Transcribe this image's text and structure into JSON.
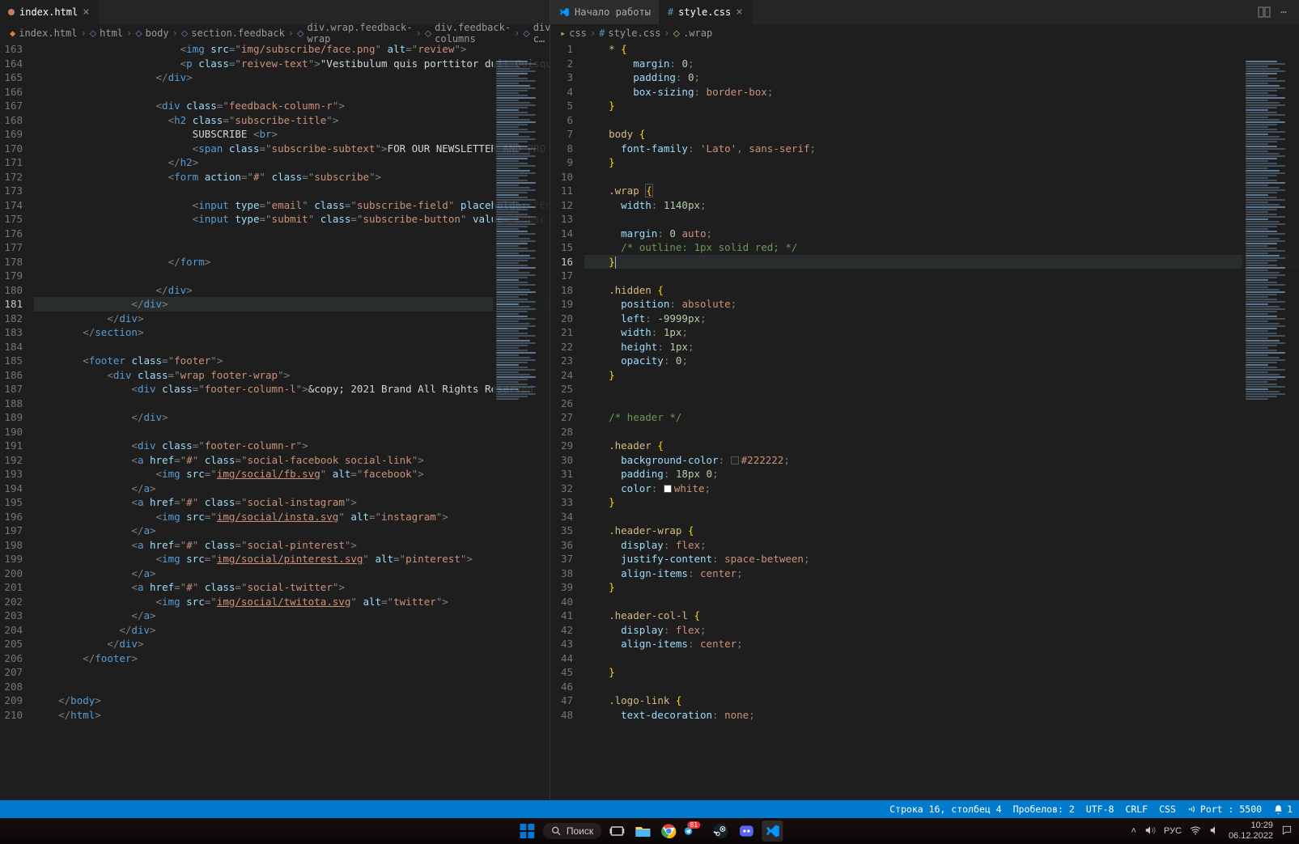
{
  "tabs_left": {
    "t0": {
      "label": "index.html",
      "modified": true
    }
  },
  "tabs_right": {
    "t0": {
      "label": "Начало работы"
    },
    "t1": {
      "label": "style.css"
    }
  },
  "breadcrumb_left": [
    "index.html",
    "html",
    "body",
    "section.feedback",
    "div.wrap.feedback-wrap",
    "div.feedback-columns",
    "div.feedback-c…"
  ],
  "breadcrumb_right": [
    "css",
    "style.css",
    ".wrap"
  ],
  "left_lines": {
    "start": 163,
    "active_abs": 181,
    "lines": [
      {
        "n": 163,
        "html": "                    <span class='t-punc'>&lt;</span><span class='t-tag'>img</span> <span class='t-attr'>src</span><span class='t-punc'>=\"</span><span class='t-str'>img/subscribe/face.png</span><span class='t-punc'>\"</span> <span class='t-attr'>alt</span><span class='t-punc'>=\"</span><span class='t-str'>review</span><span class='t-punc'>\"&gt;</span>"
      },
      {
        "n": 164,
        "html": "                    <span class='t-punc'>&lt;</span><span class='t-tag'>p</span> <span class='t-attr'>class</span><span class='t-punc'>=\"</span><span class='t-str'>reivew-text</span><span class='t-punc'>\"&gt;</span><span class='t-text'>\"Vestibulum quis porttitor dui! Quisque </span>"
      },
      {
        "n": 165,
        "html": "                <span class='t-punc'>&lt;/</span><span class='t-tag'>div</span><span class='t-punc'>&gt;</span>"
      },
      {
        "n": 166,
        "html": ""
      },
      {
        "n": 167,
        "html": "                <span class='t-punc'>&lt;</span><span class='t-tag'>div</span> <span class='t-attr'>class</span><span class='t-punc'>=\"</span><span class='t-str'>feedback-column-r</span><span class='t-punc'>\"&gt;</span>"
      },
      {
        "n": 168,
        "html": "                  <span class='t-punc'>&lt;</span><span class='t-tag'>h2</span> <span class='t-attr'>class</span><span class='t-punc'>=\"</span><span class='t-str'>subscribe-title</span><span class='t-punc'>\"&gt;</span>"
      },
      {
        "n": 169,
        "html": "                      <span class='t-text'>SUBSCRIBE</span> <span class='t-punc'>&lt;</span><span class='t-tag'>br</span><span class='t-punc'>&gt;</span>"
      },
      {
        "n": 170,
        "html": "                      <span class='t-punc'>&lt;</span><span class='t-tag'>span</span> <span class='t-attr'>class</span><span class='t-punc'>=\"</span><span class='t-str'>subscribe-subtext</span><span class='t-punc'>\"&gt;</span><span class='t-text'>FOR OUR NEWSLETTER AND PRO</span>"
      },
      {
        "n": 171,
        "html": "                  <span class='t-punc'>&lt;/</span><span class='t-tag'>h2</span><span class='t-punc'>&gt;</span>"
      },
      {
        "n": 172,
        "html": "                  <span class='t-punc'>&lt;</span><span class='t-tag'>form</span> <span class='t-attr'>action</span><span class='t-punc'>=\"</span><span class='t-str'>#</span><span class='t-punc'>\"</span> <span class='t-attr'>class</span><span class='t-punc'>=\"</span><span class='t-str'>subscribe</span><span class='t-punc'>\"&gt;</span>"
      },
      {
        "n": 173,
        "html": ""
      },
      {
        "n": 174,
        "html": "                      <span class='t-punc'>&lt;</span><span class='t-tag'>input</span> <span class='t-attr'>type</span><span class='t-punc'>=\"</span><span class='t-str'>email</span><span class='t-punc'>\"</span> <span class='t-attr'>class</span><span class='t-punc'>=\"</span><span class='t-str'>subscribe-field</span><span class='t-punc'>\"</span> <span class='t-attr'>placeholder</span><span class='t-punc'>=\"</span><span class='t-str'>En</span>"
      },
      {
        "n": 175,
        "html": "                      <span class='t-punc'>&lt;</span><span class='t-tag'>input</span> <span class='t-attr'>type</span><span class='t-punc'>=\"</span><span class='t-str'>submit</span><span class='t-punc'>\"</span> <span class='t-attr'>class</span><span class='t-punc'>=\"</span><span class='t-str'>subscribe-button</span><span class='t-punc'>\"</span> <span class='t-attr'>value</span><span class='t-punc'>=\"</span><span class='t-str'>Subsc</span>"
      },
      {
        "n": 176,
        "html": ""
      },
      {
        "n": 177,
        "html": ""
      },
      {
        "n": 178,
        "html": "                  <span class='t-punc'>&lt;/</span><span class='t-tag'>form</span><span class='t-punc'>&gt;</span>"
      },
      {
        "n": 179,
        "html": ""
      },
      {
        "n": 180,
        "html": "                <span class='t-punc'>&lt;/</span><span class='t-tag'>div</span><span class='t-punc'>&gt;</span>"
      },
      {
        "n": 181,
        "html": "            <span class='t-punc'>&lt;/</span><span class='t-tag'>div</span><span class='t-punc'>&gt;</span>"
      },
      {
        "n": 182,
        "html": "        <span class='t-punc'>&lt;/</span><span class='t-tag'>div</span><span class='t-punc'>&gt;</span>"
      },
      {
        "n": 183,
        "html": "    <span class='t-punc'>&lt;/</span><span class='t-tag'>section</span><span class='t-punc'>&gt;</span>"
      },
      {
        "n": 184,
        "html": ""
      },
      {
        "n": 185,
        "html": "    <span class='t-punc'>&lt;</span><span class='t-tag'>footer</span> <span class='t-attr'>class</span><span class='t-punc'>=\"</span><span class='t-str'>footer</span><span class='t-punc'>\"&gt;</span>"
      },
      {
        "n": 186,
        "html": "        <span class='t-punc'>&lt;</span><span class='t-tag'>div</span> <span class='t-attr'>class</span><span class='t-punc'>=\"</span><span class='t-str'>wrap footer-wrap</span><span class='t-punc'>\"&gt;</span>"
      },
      {
        "n": 187,
        "html": "            <span class='t-punc'>&lt;</span><span class='t-tag'>div</span> <span class='t-attr'>class</span><span class='t-punc'>=\"</span><span class='t-str'>footer-column-l</span><span class='t-punc'>\"&gt;</span><span class='t-text'>&amp;copy; 2021 Brand All Rights Reserved</span>"
      },
      {
        "n": 188,
        "html": ""
      },
      {
        "n": 189,
        "html": "            <span class='t-punc'>&lt;/</span><span class='t-tag'>div</span><span class='t-punc'>&gt;</span>"
      },
      {
        "n": 190,
        "html": ""
      },
      {
        "n": 191,
        "html": "            <span class='t-punc'>&lt;</span><span class='t-tag'>div</span> <span class='t-attr'>class</span><span class='t-punc'>=\"</span><span class='t-str'>footer-column-r</span><span class='t-punc'>\"&gt;</span>"
      },
      {
        "n": 192,
        "html": "            <span class='t-punc'>&lt;</span><span class='t-tag'>a</span> <span class='t-attr'>href</span><span class='t-punc'>=\"</span><span class='t-str'>#</span><span class='t-punc'>\"</span> <span class='t-attr'>class</span><span class='t-punc'>=\"</span><span class='t-str'>social-facebook social-link</span><span class='t-punc'>\"&gt;</span>"
      },
      {
        "n": 193,
        "html": "                <span class='t-punc'>&lt;</span><span class='t-tag'>img</span> <span class='t-attr'>src</span><span class='t-punc'>=\"</span><span class='t-link'>img/social/fb.svg</span><span class='t-punc'>\"</span> <span class='t-attr'>alt</span><span class='t-punc'>=\"</span><span class='t-str'>facebook</span><span class='t-punc'>\"&gt;</span>"
      },
      {
        "n": 194,
        "html": "            <span class='t-punc'>&lt;/</span><span class='t-tag'>a</span><span class='t-punc'>&gt;</span>"
      },
      {
        "n": 195,
        "html": "            <span class='t-punc'>&lt;</span><span class='t-tag'>a</span> <span class='t-attr'>href</span><span class='t-punc'>=\"</span><span class='t-str'>#</span><span class='t-punc'>\"</span> <span class='t-attr'>class</span><span class='t-punc'>=\"</span><span class='t-str'>social-instagram</span><span class='t-punc'>\"&gt;</span>"
      },
      {
        "n": 196,
        "html": "                <span class='t-punc'>&lt;</span><span class='t-tag'>img</span> <span class='t-attr'>src</span><span class='t-punc'>=\"</span><span class='t-link'>img/social/insta.svg</span><span class='t-punc'>\"</span> <span class='t-attr'>alt</span><span class='t-punc'>=\"</span><span class='t-str'>instagram</span><span class='t-punc'>\"&gt;</span>"
      },
      {
        "n": 197,
        "html": "            <span class='t-punc'>&lt;/</span><span class='t-tag'>a</span><span class='t-punc'>&gt;</span>"
      },
      {
        "n": 198,
        "html": "            <span class='t-punc'>&lt;</span><span class='t-tag'>a</span> <span class='t-attr'>href</span><span class='t-punc'>=\"</span><span class='t-str'>#</span><span class='t-punc'>\"</span> <span class='t-attr'>class</span><span class='t-punc'>=\"</span><span class='t-str'>social-pinterest</span><span class='t-punc'>\"&gt;</span>"
      },
      {
        "n": 199,
        "html": "                <span class='t-punc'>&lt;</span><span class='t-tag'>img</span> <span class='t-attr'>src</span><span class='t-punc'>=\"</span><span class='t-link'>img/social/pinterest.svg</span><span class='t-punc'>\"</span> <span class='t-attr'>alt</span><span class='t-punc'>=\"</span><span class='t-str'>pinterest</span><span class='t-punc'>\"&gt;</span>"
      },
      {
        "n": 200,
        "html": "            <span class='t-punc'>&lt;/</span><span class='t-tag'>a</span><span class='t-punc'>&gt;</span>"
      },
      {
        "n": 201,
        "html": "            <span class='t-punc'>&lt;</span><span class='t-tag'>a</span> <span class='t-attr'>href</span><span class='t-punc'>=\"</span><span class='t-str'>#</span><span class='t-punc'>\"</span> <span class='t-attr'>class</span><span class='t-punc'>=\"</span><span class='t-str'>social-twitter</span><span class='t-punc'>\"&gt;</span>"
      },
      {
        "n": 202,
        "html": "                <span class='t-punc'>&lt;</span><span class='t-tag'>img</span> <span class='t-attr'>src</span><span class='t-punc'>=\"</span><span class='t-link'>img/social/twitota.svg</span><span class='t-punc'>\"</span> <span class='t-attr'>alt</span><span class='t-punc'>=\"</span><span class='t-str'>twitter</span><span class='t-punc'>\"&gt;</span>"
      },
      {
        "n": 203,
        "html": "            <span class='t-punc'>&lt;/</span><span class='t-tag'>a</span><span class='t-punc'>&gt;</span>"
      },
      {
        "n": 204,
        "html": "          <span class='t-punc'>&lt;/</span><span class='t-tag'>div</span><span class='t-punc'>&gt;</span>"
      },
      {
        "n": 205,
        "html": "        <span class='t-punc'>&lt;/</span><span class='t-tag'>div</span><span class='t-punc'>&gt;</span>"
      },
      {
        "n": 206,
        "html": "    <span class='t-punc'>&lt;/</span><span class='t-tag'>footer</span><span class='t-punc'>&gt;</span>"
      },
      {
        "n": 207,
        "html": ""
      },
      {
        "n": 208,
        "html": ""
      },
      {
        "n": 209,
        "html": "<span class='t-punc'>&lt;/</span><span class='t-tag'>body</span><span class='t-punc'>&gt;</span>"
      },
      {
        "n": 210,
        "html": "<span class='t-punc'>&lt;/</span><span class='t-tag'>html</span><span class='t-punc'>&gt;</span>"
      }
    ]
  },
  "right_lines": {
    "start": 1,
    "active_abs": 16,
    "lines": [
      {
        "n": 1,
        "html": "<span class='t-sel'>*</span> <span class='t-brace'>{</span>"
      },
      {
        "n": 2,
        "html": "    <span class='t-prop'>margin</span><span class='t-punc'>:</span> <span class='t-num'>0</span><span class='t-punc'>;</span>"
      },
      {
        "n": 3,
        "html": "    <span class='t-prop'>padding</span><span class='t-punc'>:</span> <span class='t-num'>0</span><span class='t-punc'>;</span>"
      },
      {
        "n": 4,
        "html": "    <span class='t-prop'>box-sizing</span><span class='t-punc'>:</span> <span class='t-val'>border-box</span><span class='t-punc'>;</span>"
      },
      {
        "n": 5,
        "html": "<span class='t-brace'>}</span>"
      },
      {
        "n": 6,
        "html": ""
      },
      {
        "n": 7,
        "html": "<span class='t-sel'>body</span> <span class='t-brace'>{</span>"
      },
      {
        "n": 8,
        "html": "  <span class='t-prop'>font-family</span><span class='t-punc'>:</span> <span class='t-val'>'Lato'</span><span class='t-punc'>,</span> <span class='t-val'>sans-serif</span><span class='t-punc'>;</span>"
      },
      {
        "n": 9,
        "html": "<span class='t-brace'>}</span>"
      },
      {
        "n": 10,
        "html": ""
      },
      {
        "n": 11,
        "html": "<span class='t-sel'>.wrap</span> <span class='t-brace' style='border:1px solid #555'>{</span>"
      },
      {
        "n": 12,
        "html": "  <span class='t-prop'>width</span><span class='t-punc'>:</span> <span class='t-num'>1140px</span><span class='t-punc'>;</span>"
      },
      {
        "n": 13,
        "html": ""
      },
      {
        "n": 14,
        "html": "  <span class='t-prop'>margin</span><span class='t-punc'>:</span> <span class='t-num'>0</span> <span class='t-val'>auto</span><span class='t-punc'>;</span>"
      },
      {
        "n": 15,
        "html": "  <span class='t-com'>/* outline: 1px solid red; */</span>"
      },
      {
        "n": 16,
        "html": "<span class='t-brace'>}</span><span class='cursor'></span>"
      },
      {
        "n": 17,
        "html": ""
      },
      {
        "n": 18,
        "html": "<span class='t-sel'>.hidden</span> <span class='t-brace'>{</span>"
      },
      {
        "n": 19,
        "html": "  <span class='t-prop'>position</span><span class='t-punc'>:</span> <span class='t-val'>absolute</span><span class='t-punc'>;</span>"
      },
      {
        "n": 20,
        "html": "  <span class='t-prop'>left</span><span class='t-punc'>:</span> <span class='t-num'>-9999px</span><span class='t-punc'>;</span>"
      },
      {
        "n": 21,
        "html": "  <span class='t-prop'>width</span><span class='t-punc'>:</span> <span class='t-num'>1px</span><span class='t-punc'>;</span>"
      },
      {
        "n": 22,
        "html": "  <span class='t-prop'>height</span><span class='t-punc'>:</span> <span class='t-num'>1px</span><span class='t-punc'>;</span>"
      },
      {
        "n": 23,
        "html": "  <span class='t-prop'>opacity</span><span class='t-punc'>:</span> <span class='t-num'>0</span><span class='t-punc'>;</span>"
      },
      {
        "n": 24,
        "html": "<span class='t-brace'>}</span>"
      },
      {
        "n": 25,
        "html": ""
      },
      {
        "n": 26,
        "html": ""
      },
      {
        "n": 27,
        "html": "<span class='t-com'>/* header */</span>"
      },
      {
        "n": 28,
        "html": ""
      },
      {
        "n": 29,
        "html": "<span class='t-sel'>.header</span> <span class='t-brace'>{</span>"
      },
      {
        "n": 30,
        "html": "  <span class='t-prop'>background-color</span><span class='t-punc'>:</span> <span class='t-colorbox' style='background:#222222'></span><span class='t-val'>#222222</span><span class='t-punc'>;</span>"
      },
      {
        "n": 31,
        "html": "  <span class='t-prop'>padding</span><span class='t-punc'>:</span> <span class='t-num'>18px 0</span><span class='t-punc'>;</span>"
      },
      {
        "n": 32,
        "html": "  <span class='t-prop'>color</span><span class='t-punc'>:</span> <span class='t-colorbox' style='background:#fff'></span><span class='t-val'>white</span><span class='t-punc'>;</span>"
      },
      {
        "n": 33,
        "html": "<span class='t-brace'>}</span>"
      },
      {
        "n": 34,
        "html": ""
      },
      {
        "n": 35,
        "html": "<span class='t-sel'>.header-wrap</span> <span class='t-brace'>{</span>"
      },
      {
        "n": 36,
        "html": "  <span class='t-prop'>display</span><span class='t-punc'>:</span> <span class='t-val'>flex</span><span class='t-punc'>;</span>"
      },
      {
        "n": 37,
        "html": "  <span class='t-prop'>justify-content</span><span class='t-punc'>:</span> <span class='t-val'>space-between</span><span class='t-punc'>;</span>"
      },
      {
        "n": 38,
        "html": "  <span class='t-prop'>align-items</span><span class='t-punc'>:</span> <span class='t-val'>center</span><span class='t-punc'>;</span>"
      },
      {
        "n": 39,
        "html": "<span class='t-brace'>}</span>"
      },
      {
        "n": 40,
        "html": ""
      },
      {
        "n": 41,
        "html": "<span class='t-sel'>.header-col-l</span> <span class='t-brace'>{</span>"
      },
      {
        "n": 42,
        "html": "  <span class='t-prop'>display</span><span class='t-punc'>:</span> <span class='t-val'>flex</span><span class='t-punc'>;</span>"
      },
      {
        "n": 43,
        "html": "  <span class='t-prop'>align-items</span><span class='t-punc'>:</span> <span class='t-val'>center</span><span class='t-punc'>;</span>"
      },
      {
        "n": 44,
        "html": ""
      },
      {
        "n": 45,
        "html": "<span class='t-brace'>}</span>"
      },
      {
        "n": 46,
        "html": ""
      },
      {
        "n": 47,
        "html": "<span class='t-sel'>.logo-link</span> <span class='t-brace'>{</span>"
      },
      {
        "n": 48,
        "html": "  <span class='t-prop'>text-decoration</span><span class='t-punc'>:</span> <span class='t-val'>none</span><span class='t-punc'>;</span>"
      }
    ]
  },
  "statusbar": {
    "cursor": "Строка 16, столбец 4",
    "spaces": "Пробелов: 2",
    "encoding": "UTF-8",
    "eol": "CRLF",
    "lang": "CSS",
    "port": "Port : 5500",
    "notif": "1"
  },
  "taskbar": {
    "search": "Поиск",
    "lang": "РУС",
    "time": "10:29",
    "date": "06.12.2022",
    "badge": "81"
  }
}
